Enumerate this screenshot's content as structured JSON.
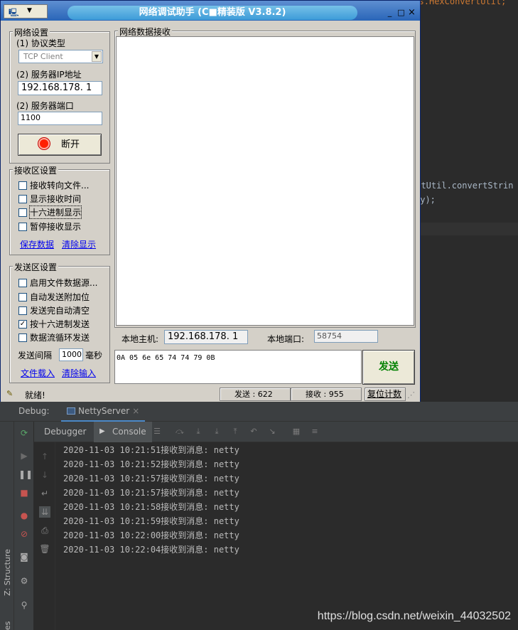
{
  "window": {
    "title": "网络调试助手 (C■精装版 V3.8.2)",
    "buttons": {
      "minimize": "_",
      "maximize": "□",
      "close": "×"
    }
  },
  "network_settings": {
    "group_title": "网络设置",
    "protocol_label": "(1) 协议类型",
    "protocol_value": "TCP Client",
    "ip_label": "(2) 服务器IP地址",
    "ip_value": "192.168.178. 1",
    "port_label": "(2) 服务器端口",
    "port_value": "1100",
    "disconnect_button": "断开"
  },
  "receive_settings": {
    "group_title": "接收区设置",
    "options": [
      {
        "label": "接收转向文件...",
        "checked": false
      },
      {
        "label": "显示接收时间",
        "checked": false
      },
      {
        "label": "十六进制显示",
        "checked": false
      },
      {
        "label": "暂停接收显示",
        "checked": false
      }
    ],
    "save_link": "保存数据",
    "clear_link": "清除显示"
  },
  "send_settings": {
    "group_title": "发送区设置",
    "options": [
      {
        "label": "启用文件数据源...",
        "checked": false
      },
      {
        "label": "自动发送附加位",
        "checked": false
      },
      {
        "label": "发送完自动清空",
        "checked": false
      },
      {
        "label": "按十六进制发送",
        "checked": true
      },
      {
        "label": "数据流循环发送",
        "checked": false
      }
    ],
    "interval_label": "发送间隔",
    "interval_value": "1000",
    "interval_unit": "毫秒",
    "file_link": "文件载入",
    "clear_link": "清除输入"
  },
  "receive_panel": {
    "title": "网络数据接收",
    "local_host_label": "本地主机:",
    "local_host_value": "192.168.178. 1",
    "local_port_label": "本地端口:",
    "local_port_value": "58754"
  },
  "send_panel": {
    "input_value": "0A 05 6e 65 74 74 79 0B",
    "send_button": "发送"
  },
  "status_bar": {
    "status_text": "就绪!",
    "send_count": "发送 : 622",
    "recv_count": "接收 : 955",
    "reset_button": "复位计数"
  },
  "editor_snippet": {
    "import_line": "import com.github.custom.utils.HexConvertUtil;",
    "code_line1": "ertUtil.convertStrin",
    "code_line2": "ty);"
  },
  "ide": {
    "debug_label": "Debug:",
    "run_tab": "NettyServer",
    "subtabs": [
      "Debugger",
      "Console"
    ],
    "side_labels": [
      "Z: Structure",
      "avorites"
    ],
    "console_lines": [
      "2020-11-03 10:21:51接收到消息: netty",
      "2020-11-03 10:21:52接收到消息: netty",
      "2020-11-03 10:21:57接收到消息: netty",
      "2020-11-03 10:21:57接收到消息: netty",
      "2020-11-03 10:21:58接收到消息: netty",
      "2020-11-03 10:21:59接收到消息: netty",
      "2020-11-03 10:22:00接收到消息: netty",
      "2020-11-03 10:22:04接收到消息: netty"
    ]
  },
  "watermark": "https://blog.csdn.net/weixin_44032502",
  "colors": {
    "title_gradient": "#3d9bd8",
    "send_button_text": "#008000",
    "ide_bg": "#2b2b2b",
    "link": "#0000ee"
  }
}
